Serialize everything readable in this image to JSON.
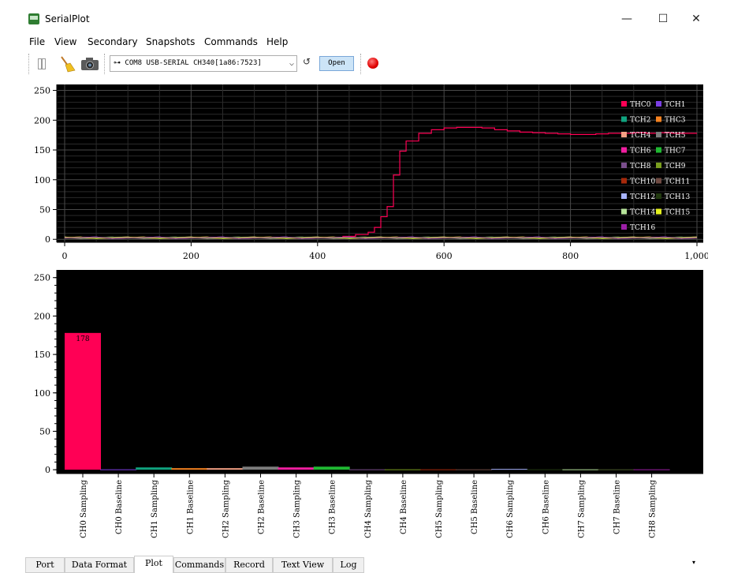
{
  "window": {
    "title": "SerialPlot",
    "min_glyph": "—",
    "max_glyph": "☐",
    "close_glyph": "✕"
  },
  "menu": [
    "File",
    "View",
    "Secondary",
    "Snapshots",
    "Commands",
    "Help"
  ],
  "toolbar": {
    "port_value": "⊶ COM8 USB-SERIAL CH340[1a86:7523]",
    "dropdown_glyph": "⌵",
    "refresh_glyph": "↺",
    "open_label": "Open",
    "icons": [
      "pause-icon",
      "clear-icon",
      "snapshot-icon",
      "record-icon"
    ]
  },
  "colors": {
    "plot_background": "#000000",
    "grid": "#333333",
    "highlight_series": "#ff0055",
    "record": "#e00000"
  },
  "tabs": [
    "Port",
    "Data Format",
    "Plot",
    "Commands",
    "Record",
    "Text View",
    "Log"
  ],
  "active_tab": "Plot",
  "tab_scroll_glyph": "▾",
  "chart_data": [
    {
      "type": "line",
      "x_ticks": [
        0,
        200,
        400,
        600,
        800,
        1000
      ],
      "x_tick_labels": [
        "0",
        "200",
        "400",
        "600",
        "800",
        "1,000"
      ],
      "xlim": [
        0,
        1000
      ],
      "y_ticks": [
        0,
        50,
        100,
        150,
        200,
        250
      ],
      "ylim": [
        -5,
        260
      ],
      "grid": true,
      "legend_position": "right",
      "legend": [
        {
          "name": "THC0",
          "color": "#ff0055"
        },
        {
          "name": "TCH1",
          "color": "#7b3fe4"
        },
        {
          "name": "TCH2",
          "color": "#10a37f"
        },
        {
          "name": "THC3",
          "color": "#f58220"
        },
        {
          "name": "TCH4",
          "color": "#f4a084"
        },
        {
          "name": "TCH5",
          "color": "#7d7d7d"
        },
        {
          "name": "TCH6",
          "color": "#f01ea0"
        },
        {
          "name": "THC7",
          "color": "#1fb832"
        },
        {
          "name": "TCH8",
          "color": "#7a4e8c"
        },
        {
          "name": "TCH9",
          "color": "#7a9e1f"
        },
        {
          "name": "TCH10",
          "color": "#a6290b"
        },
        {
          "name": "TCH11",
          "color": "#6e4a42"
        },
        {
          "name": "TCH12",
          "color": "#a8b4ff"
        },
        {
          "name": "TCH13",
          "color": "#223a10"
        },
        {
          "name": "TCH14",
          "color": "#b7e49a"
        },
        {
          "name": "TCH15",
          "color": "#e4f01e"
        },
        {
          "name": "TCH16",
          "color": "#9c1fa6"
        }
      ],
      "series": [
        {
          "name": "THC0",
          "x": [
            0,
            440,
            460,
            480,
            490,
            500,
            510,
            520,
            530,
            540,
            560,
            580,
            600,
            620,
            640,
            660,
            680,
            700,
            720,
            740,
            760,
            780,
            800,
            820,
            840,
            860,
            880,
            900,
            920,
            940,
            960,
            980,
            1000
          ],
          "y": [
            2,
            5,
            8,
            12,
            20,
            38,
            55,
            108,
            148,
            165,
            178,
            184,
            187,
            188,
            188,
            187,
            184,
            182,
            180,
            179,
            178,
            177,
            176,
            176,
            177,
            178,
            178,
            179,
            178,
            179,
            178,
            178,
            178
          ]
        }
      ]
    },
    {
      "type": "bar",
      "categories": [
        "CH0 Sampling",
        "CH0 Baseline",
        "CH1 Sampling",
        "CH1 Baseline",
        "CH2 Sampling",
        "CH2 Baseline",
        "CH3 Sampling",
        "CH3 Baseline",
        "CH4 Sampling",
        "CH4 Baseline",
        "CH5 Sampling",
        "CH5 Baseline",
        "CH6 Sampling",
        "CH6 Baseline",
        "CH7 Sampling",
        "CH7 Baseline",
        "CH8 Sampling"
      ],
      "values": [
        178,
        0.5,
        3,
        2,
        2,
        4,
        3,
        4,
        0.5,
        0.5,
        0.5,
        0.5,
        1,
        0.5,
        0.5,
        0.5,
        0.5
      ],
      "colors": [
        "#ff0055",
        "#7b3fe4",
        "#10a37f",
        "#f58220",
        "#f4a084",
        "#7d7d7d",
        "#f01ea0",
        "#1fb832",
        "#7a4e8c",
        "#7a9e1f",
        "#a6290b",
        "#6e4a42",
        "#a8b4ff",
        "#223a10",
        "#b7e49a",
        "#4a5a2a",
        "#9c1fa6"
      ],
      "data_labels": [
        "178"
      ],
      "y_ticks": [
        0,
        50,
        100,
        150,
        200,
        250
      ],
      "ylim": [
        -5,
        260
      ],
      "grid": false
    }
  ]
}
